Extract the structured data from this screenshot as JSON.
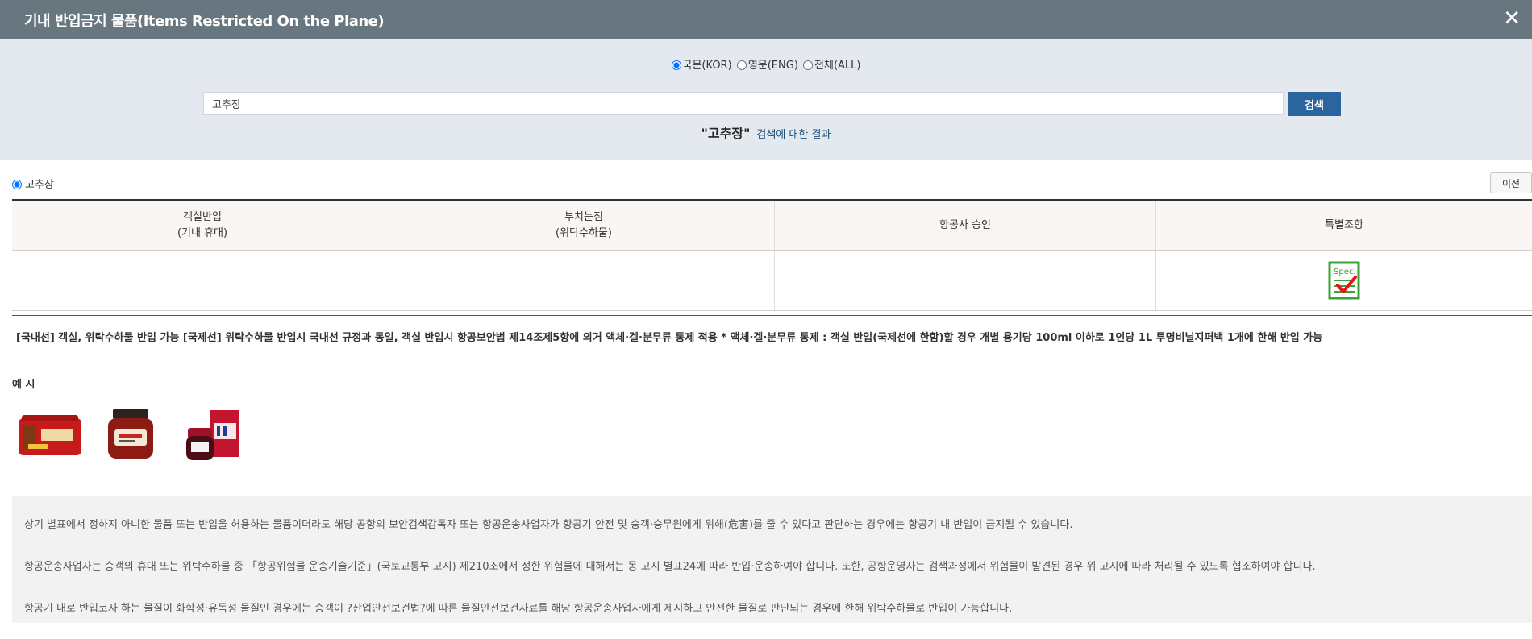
{
  "header": {
    "title": "기내 반입금지 물품(Items Restricted On the Plane)",
    "close": "✕"
  },
  "search": {
    "radios": [
      {
        "label": "국문(KOR)",
        "checked": true
      },
      {
        "label": "영문(ENG)",
        "checked": false
      },
      {
        "label": "전체(ALL)",
        "checked": false
      }
    ],
    "query": "고추장",
    "button": "검색",
    "result_term": "\"고추장\"",
    "result_suffix": "검색에 대한 결과"
  },
  "item": {
    "name": "고추장",
    "prev_button": "이전"
  },
  "table": {
    "headers": [
      {
        "line1": "객실반입",
        "line2": "(기내 휴대)"
      },
      {
        "line1": "부치는짐",
        "line2": "(위탁수하물)"
      },
      {
        "line1": "항공사 승인",
        "line2": ""
      },
      {
        "line1": "특별조항",
        "line2": ""
      }
    ],
    "spec_icon_text": "Spec."
  },
  "description": "[국내선] 객실, 위탁수하물 반입 가능 [국제선] 위탁수하물 반입시 국내선 규정과 동일, 객실 반입시 항공보안법 제14조제5항에 의거 액체·겔·분무류 통제 적용 * 액체·겔·분무류 통제 : 객실 반입(국제선에 한함)할 경우 개별 용기당 100ml 이하로 1인당 1L 투명비닐지퍼백 1개에 한해 반입 가능",
  "examples": {
    "label": "예 시",
    "images": [
      "gochujang-tub-image",
      "gochujang-jar-image",
      "gochujang-box-jar-image"
    ]
  },
  "notices": [
    "상기 별표에서 정하지 아니한 물품 또는 반입을 허용하는 물품이더라도 해당 공항의 보안검색감독자 또는 항공운송사업자가 항공기 안전 및 승객·승무원에게 위해(危害)를 줄 수 있다고 판단하는 경우에는 항공기 내 반입이 금지될 수 있습니다.",
    "항공운송사업자는 승객의 휴대 또는 위탁수하물 중 「항공위험물 운송기술기준」(국토교통부 고시) 제210조에서 정한 위험물에 대해서는 동 고시 별표24에 따라 반입·운송하여야 합니다. 또한, 공항운영자는 검색과정에서 위험물이 발견된 경우 위 고시에 따라 처리될 수 있도록 협조하여야 합니다.",
    "항공기 내로 반입코자 하는 물질이 화학성·유독성 물질인 경우에는 승객이 ?산업안전보건법?에 따른 물질안전보건자료를 해당 항공운송사업자에게 제시하고 안전한 물질로 판단되는 경우에 한해 위탁수하물로 반입이 가능합니다."
  ],
  "colors": {
    "header": "#68767f",
    "search_bg": "#e3e9ee",
    "button": "#2c64a0",
    "spec_green": "#3aa335",
    "check_red": "#e01818"
  }
}
